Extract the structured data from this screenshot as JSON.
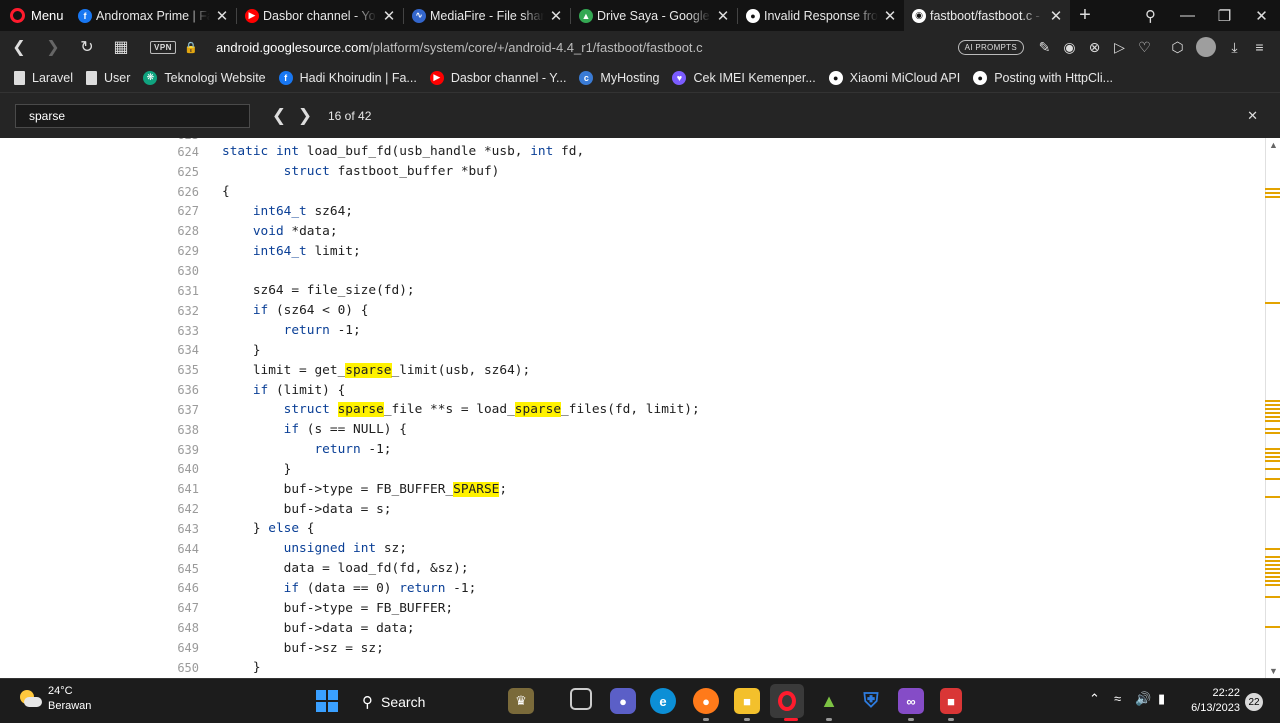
{
  "browser": {
    "menu_label": "Menu",
    "tabs": [
      {
        "title": "Andromax Prime | Face",
        "icon": "facebook-icon",
        "color": "#1877f2"
      },
      {
        "title": "Dasbor channel - YouTu",
        "icon": "youtube-icon",
        "color": "#ff0000"
      },
      {
        "title": "MediaFire - File sharing",
        "icon": "mediafire-icon",
        "color": "#3366cc"
      },
      {
        "title": "Drive Saya - Google Dr",
        "icon": "google-drive-icon",
        "color": "#34a853"
      },
      {
        "title": "Invalid Response from",
        "icon": "github-icon",
        "color": "#ffffff"
      },
      {
        "title": "fastboot/fastboot.c - pl",
        "icon": "globe-icon",
        "color": "#ffffff",
        "active": true
      }
    ],
    "vpn_label": "VPN",
    "url_domain": "android.googlesource.com",
    "url_path": "/platform/system/core/+/android-4.4_r1/fastboot/fastboot.c",
    "ai_prompts_label": "AI PROMPTS"
  },
  "bookmarks": [
    {
      "label": "Laravel",
      "icon": "document-icon"
    },
    {
      "label": "User",
      "icon": "document-icon"
    },
    {
      "label": "Teknologi Website",
      "icon": "openai-icon"
    },
    {
      "label": "Hadi Khoirudin | Fa...",
      "icon": "facebook-icon"
    },
    {
      "label": "Dasbor channel - Y...",
      "icon": "youtube-icon"
    },
    {
      "label": "MyHosting",
      "icon": "myhosting-icon"
    },
    {
      "label": "Cek IMEI Kemenper...",
      "icon": "heart-icon"
    },
    {
      "label": "Xiaomi MiCloud API",
      "icon": "github-icon"
    },
    {
      "label": "Posting with HttpCli...",
      "icon": "github-icon"
    }
  ],
  "find": {
    "query": "sparse",
    "count": "16 of 42"
  },
  "code": {
    "partial_top": "623",
    "lines": [
      {
        "n": "624",
        "segs": [
          [
            "kw",
            "static "
          ],
          [
            "kw",
            "int "
          ],
          [
            "",
            "load_buf_fd(usb_handle *usb, "
          ],
          [
            "kw",
            "int "
          ],
          [
            "",
            "fd,"
          ]
        ]
      },
      {
        "n": "625",
        "segs": [
          [
            "",
            "        "
          ],
          [
            "kw",
            "struct "
          ],
          [
            "",
            "fastboot_buffer *buf)"
          ]
        ]
      },
      {
        "n": "626",
        "segs": [
          [
            "",
            "{"
          ]
        ]
      },
      {
        "n": "627",
        "segs": [
          [
            "",
            "    "
          ],
          [
            "kw",
            "int64_t "
          ],
          [
            "",
            "sz64;"
          ]
        ]
      },
      {
        "n": "628",
        "segs": [
          [
            "",
            "    "
          ],
          [
            "kw",
            "void "
          ],
          [
            "",
            "*data;"
          ]
        ]
      },
      {
        "n": "629",
        "segs": [
          [
            "",
            "    "
          ],
          [
            "kw",
            "int64_t "
          ],
          [
            "",
            "limit;"
          ]
        ]
      },
      {
        "n": "630",
        "segs": [
          [
            "",
            ""
          ]
        ]
      },
      {
        "n": "631",
        "segs": [
          [
            "",
            "    sz64 = file_size(fd);"
          ]
        ]
      },
      {
        "n": "632",
        "segs": [
          [
            "",
            "    "
          ],
          [
            "kw",
            "if "
          ],
          [
            "",
            "(sz64 < 0) {"
          ]
        ]
      },
      {
        "n": "633",
        "segs": [
          [
            "",
            "        "
          ],
          [
            "kw",
            "return "
          ],
          [
            "",
            "-1;"
          ]
        ]
      },
      {
        "n": "634",
        "segs": [
          [
            "",
            "    }"
          ]
        ]
      },
      {
        "n": "635",
        "segs": [
          [
            "",
            "    limit = get_"
          ],
          [
            "hl",
            "sparse"
          ],
          [
            "",
            "_limit(usb, sz64);"
          ]
        ]
      },
      {
        "n": "636",
        "segs": [
          [
            "",
            "    "
          ],
          [
            "kw",
            "if "
          ],
          [
            "",
            "(limit) {"
          ]
        ]
      },
      {
        "n": "637",
        "segs": [
          [
            "",
            "        "
          ],
          [
            "kw",
            "struct "
          ],
          [
            "hl",
            "sparse"
          ],
          [
            "",
            "_file **s = load_"
          ],
          [
            "hl",
            "sparse"
          ],
          [
            "",
            "_files(fd, limit);"
          ]
        ]
      },
      {
        "n": "638",
        "segs": [
          [
            "",
            "        "
          ],
          [
            "kw",
            "if "
          ],
          [
            "",
            "(s == NULL) {"
          ]
        ]
      },
      {
        "n": "639",
        "segs": [
          [
            "",
            "            "
          ],
          [
            "kw",
            "return "
          ],
          [
            "",
            "-1;"
          ]
        ]
      },
      {
        "n": "640",
        "segs": [
          [
            "",
            "        }"
          ]
        ]
      },
      {
        "n": "641",
        "segs": [
          [
            "",
            "        buf->type = FB_BUFFER_"
          ],
          [
            "hl",
            "SPARSE"
          ],
          [
            "",
            ";"
          ]
        ]
      },
      {
        "n": "642",
        "segs": [
          [
            "",
            "        buf->data = s;"
          ]
        ]
      },
      {
        "n": "643",
        "segs": [
          [
            "",
            "    } "
          ],
          [
            "kw",
            "else "
          ],
          [
            "",
            "{"
          ]
        ]
      },
      {
        "n": "644",
        "segs": [
          [
            "",
            "        "
          ],
          [
            "kw",
            "unsigned "
          ],
          [
            "kw",
            "int "
          ],
          [
            "",
            "sz;"
          ]
        ]
      },
      {
        "n": "645",
        "segs": [
          [
            "",
            "        data = load_fd(fd, &sz);"
          ]
        ]
      },
      {
        "n": "646",
        "segs": [
          [
            "",
            "        "
          ],
          [
            "kw",
            "if "
          ],
          [
            "",
            "(data == 0) "
          ],
          [
            "kw",
            "return "
          ],
          [
            "",
            "-1;"
          ]
        ]
      },
      {
        "n": "647",
        "segs": [
          [
            "",
            "        buf->type = FB_BUFFER;"
          ]
        ]
      },
      {
        "n": "648",
        "segs": [
          [
            "",
            "        buf->data = data;"
          ]
        ]
      },
      {
        "n": "649",
        "segs": [
          [
            "",
            "        buf->sz = sz;"
          ]
        ]
      },
      {
        "n": "650",
        "segs": [
          [
            "",
            "    }"
          ]
        ]
      }
    ]
  },
  "taskbar": {
    "temperature": "24°C",
    "weather_desc": "Berawan",
    "search_label": "Search",
    "time": "22:22",
    "date": "6/13/2023",
    "notification_count": "22"
  },
  "colors": {
    "keyword": "#0a3f96",
    "highlight": "#fff200",
    "accent": "#ff1b2d"
  }
}
